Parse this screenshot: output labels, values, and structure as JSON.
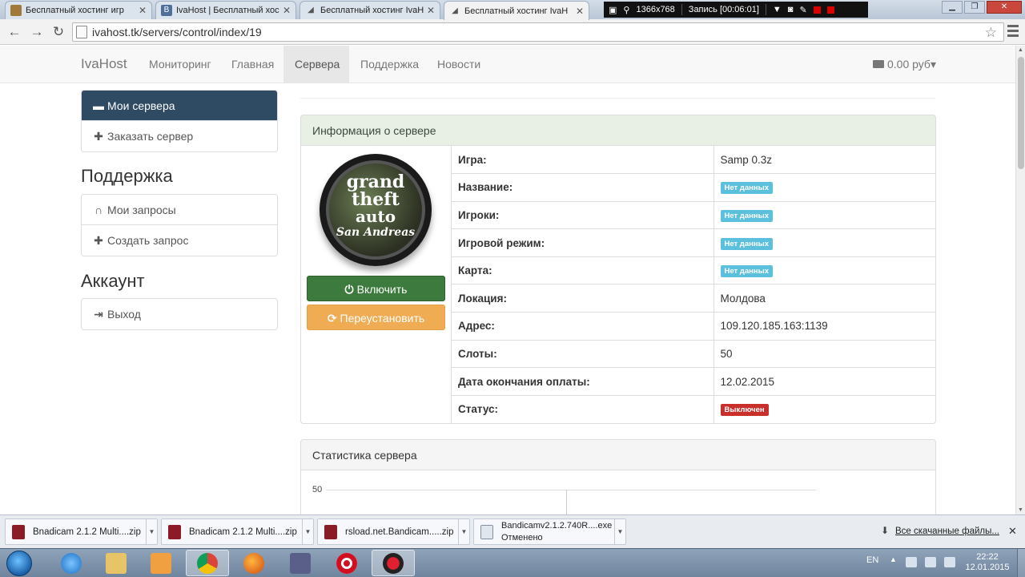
{
  "browser": {
    "tabs": [
      {
        "title": "Бесплатный хостинг игр",
        "active": false
      },
      {
        "title": "IvaHost | Бесплатный хос",
        "active": false
      },
      {
        "title": "Бесплатный хостинг IvaH",
        "active": false
      },
      {
        "title": "Бесплатный хостинг IvaH",
        "active": true
      }
    ],
    "url": "ivahost.tk/servers/control/index/19",
    "recorder": {
      "resolution": "1366x768",
      "status": "Запись [00:06:01]"
    }
  },
  "site": {
    "brand": "IvaHost",
    "nav": [
      {
        "label": "Мониторинг",
        "active": false
      },
      {
        "label": "Главная",
        "active": false
      },
      {
        "label": "Сервера",
        "active": true
      },
      {
        "label": "Поддержка",
        "active": false
      },
      {
        "label": "Новости",
        "active": false
      }
    ],
    "balance": "0.00 руб"
  },
  "sidebar": {
    "servers": [
      {
        "label": "Мои сервера",
        "icon": "hdd-icon",
        "active": true
      },
      {
        "label": "Заказать сервер",
        "icon": "plus-icon",
        "active": false
      }
    ],
    "support_heading": "Поддержка",
    "support": [
      {
        "label": "Мои запросы",
        "icon": "headphones-icon"
      },
      {
        "label": "Создать запрос",
        "icon": "plus-icon"
      }
    ],
    "account_heading": "Аккаунт",
    "account": [
      {
        "label": "Выход",
        "icon": "logout-icon"
      }
    ]
  },
  "server_panel": {
    "title": "Информация о сервере",
    "game_logo_text": [
      "grand",
      "theft",
      "auto",
      "San Andreas"
    ],
    "btn_start": "Включить",
    "btn_reinstall": "Переустановить",
    "rows": [
      {
        "key": "Игра:",
        "value": "Samp 0.3z",
        "badge": ""
      },
      {
        "key": "Название:",
        "value": "Нет данных",
        "badge": "info"
      },
      {
        "key": "Игроки:",
        "value": "Нет данных",
        "badge": "info"
      },
      {
        "key": "Игровой режим:",
        "value": "Нет данных",
        "badge": "info"
      },
      {
        "key": "Карта:",
        "value": "Нет данных",
        "badge": "info"
      },
      {
        "key": "Локация:",
        "value": "Молдова",
        "badge": ""
      },
      {
        "key": "Адрес:",
        "value": "109.120.185.163:1139",
        "badge": ""
      },
      {
        "key": "Слоты:",
        "value": "50",
        "badge": ""
      },
      {
        "key": "Дата окончания оплаты:",
        "value": "12.02.2015",
        "badge": ""
      },
      {
        "key": "Статус:",
        "value": "Выключен",
        "badge": "danger"
      }
    ]
  },
  "stats_panel": {
    "title": "Статистика сервера",
    "y_top_tick": "50"
  },
  "downloads": {
    "items": [
      {
        "name": "Bnadicam 2.1.2 Multi....zip",
        "sub": ""
      },
      {
        "name": "Bnadicam 2.1.2 Multi....zip",
        "sub": ""
      },
      {
        "name": "rsload.net.Bandicam.....zip",
        "sub": ""
      },
      {
        "name": "Bandicamv2.1.2.740R....exe",
        "sub": "Отменено"
      }
    ],
    "all_link": "Все скачанные файлы..."
  },
  "taskbar": {
    "lang": "EN",
    "time": "22:22",
    "date": "12.01.2015"
  },
  "colors": {
    "nav_active_bg": "#e7e7e7",
    "sidebar_active": "#2f4a63",
    "btn_success": "#3d7a3d",
    "btn_warning": "#efac52",
    "label_info": "#5bc0de",
    "label_danger": "#c9302c"
  }
}
